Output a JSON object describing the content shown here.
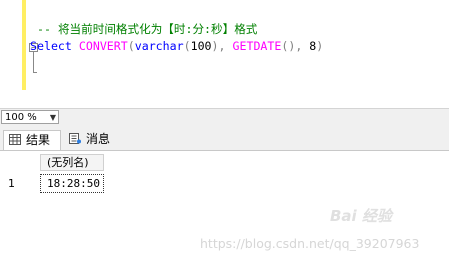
{
  "editor": {
    "comment": "-- 将当前时间格式化为【时:分:秒】格式",
    "code_tokens": [
      {
        "text": "Select ",
        "cls": "kw"
      },
      {
        "text": "CONVERT",
        "cls": "fn"
      },
      {
        "text": "(",
        "cls": "gr"
      },
      {
        "text": "varchar",
        "cls": "kw"
      },
      {
        "text": "(",
        "cls": "gr"
      },
      {
        "text": "100",
        "cls": "num"
      },
      {
        "text": "),",
        "cls": "gr"
      },
      {
        "text": " ",
        "cls": "tx"
      },
      {
        "text": "GETDATE",
        "cls": "fn"
      },
      {
        "text": "(),",
        "cls": "gr"
      },
      {
        "text": " 8",
        "cls": "num"
      },
      {
        "text": ")",
        "cls": "gr"
      }
    ],
    "fold_symbol": "−"
  },
  "zoom": {
    "value": "100 %"
  },
  "tabs": [
    {
      "label": "结果",
      "icon": "grid-icon"
    },
    {
      "label": "消息",
      "icon": "message-icon"
    }
  ],
  "results": {
    "columns": [
      "(无列名)"
    ],
    "rows": [
      {
        "num": "1",
        "cells": [
          "18:28:50"
        ]
      }
    ]
  },
  "watermark": {
    "logo": "Bai 经验",
    "url": "https://blog.csdn.net/qq_39207963"
  }
}
